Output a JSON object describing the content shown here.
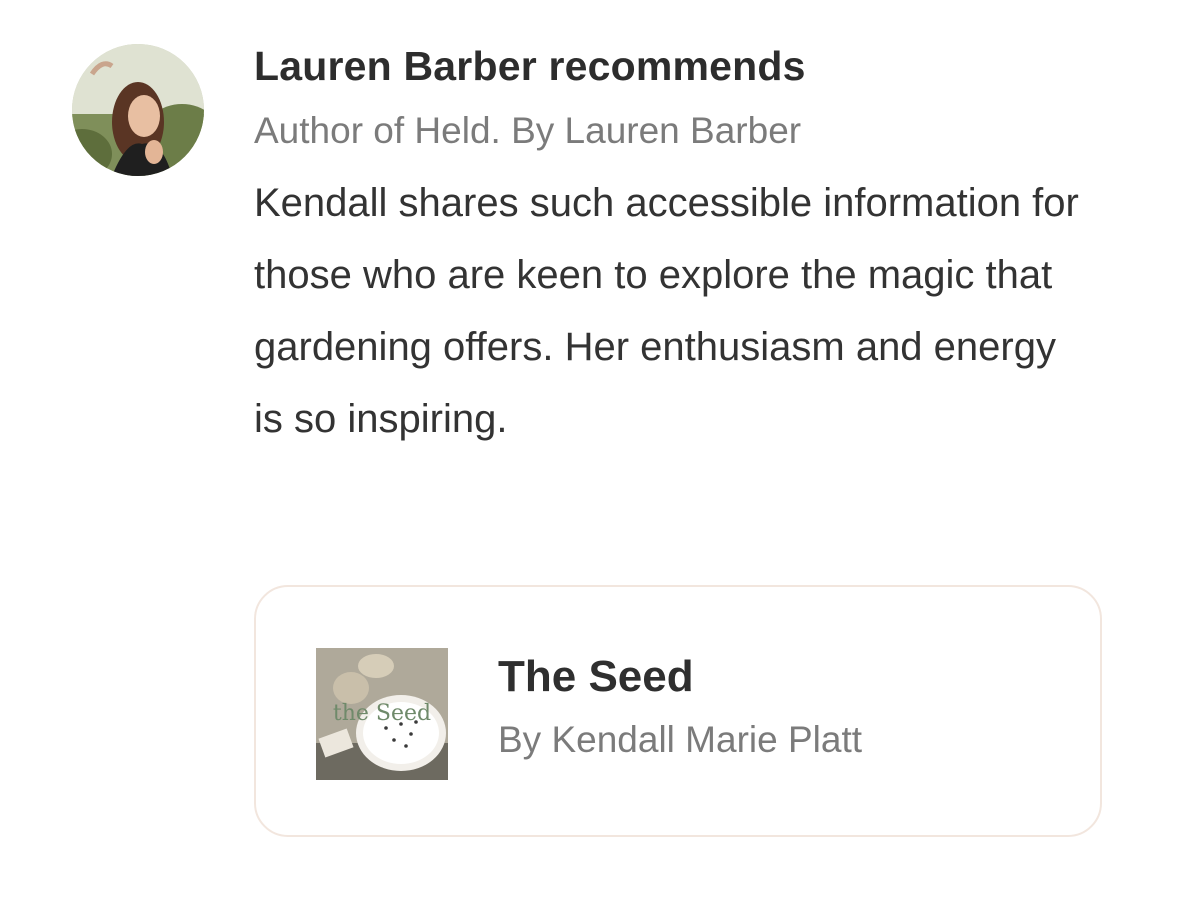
{
  "recommendation": {
    "title": "Lauren Barber recommends",
    "subtitle": "Author of Held. By Lauren Barber",
    "quote": "Kendall shares such accessible information for those who are keen to explore the magic that gardening offers. Her enthusiasm and energy is so inspiring.",
    "avatar_icon": "person-photo-avatar"
  },
  "publication": {
    "title": "The Seed",
    "author": "By Kendall Marie Platt",
    "logo_text": "the Seed",
    "logo_icon": "seed-bowl-logo"
  },
  "colors": {
    "card_border": "#f2e6de",
    "secondary_text": "#7b7b7b",
    "primary_text": "#2d2d2d"
  }
}
